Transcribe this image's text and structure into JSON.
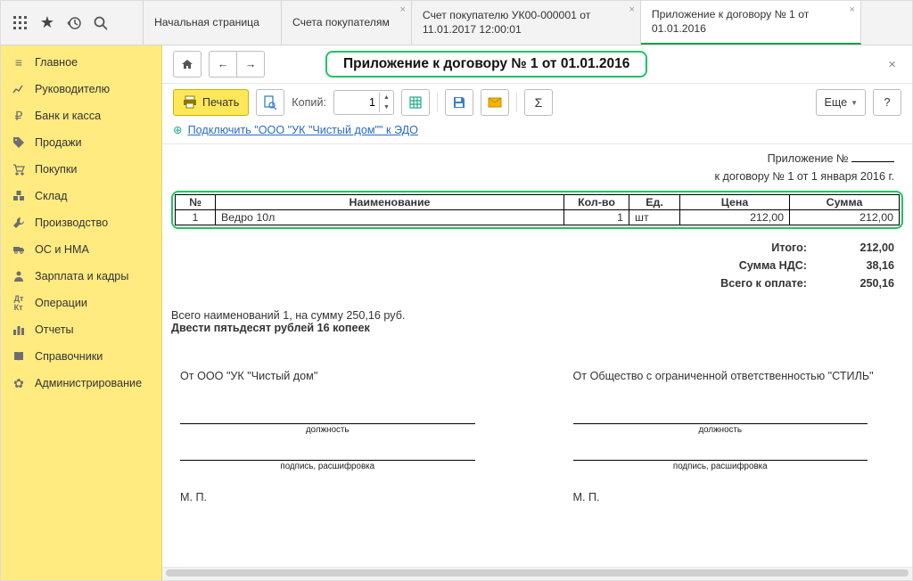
{
  "topbar": {
    "icons": {
      "apps": "apps",
      "star": "star",
      "history": "history",
      "search": "search"
    }
  },
  "tabs": [
    {
      "label": "Начальная страница"
    },
    {
      "label": "Счета покупателям"
    },
    {
      "label": "Счет покупателю УК00-000001 от 11.01.2017 12:00:01"
    },
    {
      "label": "Приложение к договору № 1 от 01.01.2016"
    }
  ],
  "sidebar": {
    "items": [
      {
        "icon": "menu",
        "label": "Главное"
      },
      {
        "icon": "chart",
        "label": "Руководителю"
      },
      {
        "icon": "ruble",
        "label": "Банк и касса"
      },
      {
        "icon": "tag",
        "label": "Продажи"
      },
      {
        "icon": "cart",
        "label": "Покупки"
      },
      {
        "icon": "boxes",
        "label": "Склад"
      },
      {
        "icon": "gear2",
        "label": "Производство"
      },
      {
        "icon": "truck",
        "label": "ОС и НМА"
      },
      {
        "icon": "person",
        "label": "Зарплата и кадры"
      },
      {
        "icon": "dtkt",
        "label": "Операции"
      },
      {
        "icon": "bars",
        "label": "Отчеты"
      },
      {
        "icon": "book",
        "label": "Справочники"
      },
      {
        "icon": "cog",
        "label": "Администрирование"
      }
    ]
  },
  "header": {
    "title": "Приложение к договору № 1 от 01.01.2016"
  },
  "toolbar": {
    "print_label": "Печать",
    "copies_label": "Копий:",
    "copies_value": "1",
    "more_label": "Еще",
    "help_label": "?"
  },
  "edo": {
    "link_text": "Подключить \"ООО \"УК \"Чистый дом\"\" к ЭДО"
  },
  "doc": {
    "head_line1_a": "Приложение №",
    "head_line2": "к договору № 1 от 1 января 2016 г.",
    "columns": {
      "num": "№",
      "name": "Наименование",
      "qty": "Кол-во",
      "unit": "Ед.",
      "price": "Цена",
      "sum": "Сумма"
    },
    "rows": [
      {
        "num": "1",
        "name": "Ведро 10л",
        "qty": "1",
        "unit": "шт",
        "price": "212,00",
        "sum": "212,00"
      }
    ],
    "totals": {
      "itogo_label": "Итого:",
      "itogo_value": "212,00",
      "nds_label": "Сумма НДС:",
      "nds_value": "38,16",
      "pay_label": "Всего к оплате:",
      "pay_value": "250,16"
    },
    "summary_line": "Всего наименований 1, на сумму 250,16 руб.",
    "summary_words": "Двести пятьдесят рублей 16 копеек",
    "sign": {
      "left_from": "От ООО \"УК \"Чистый дом\"",
      "right_from": "От Общество с ограниченной ответственностью \"СТИЛЬ\"",
      "pos_caption": "должность",
      "sig_caption": "подпись, расшифровка",
      "mp": "М. П."
    }
  }
}
